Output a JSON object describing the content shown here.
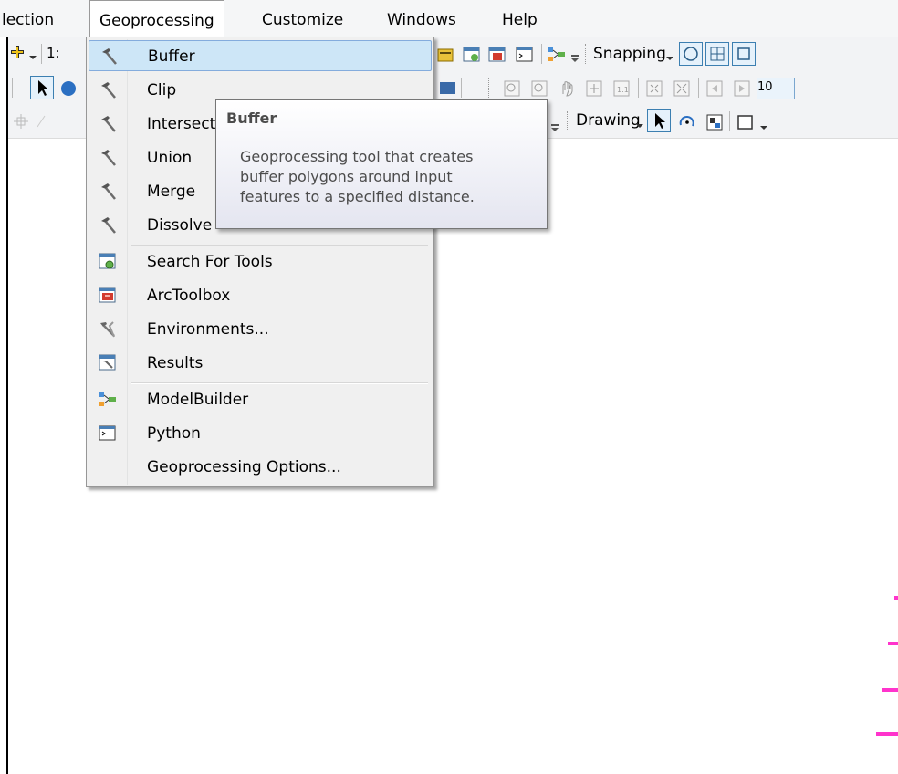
{
  "menubar": {
    "items": [
      "lection",
      "Geoprocessing",
      "Customize",
      "Windows",
      "Help"
    ]
  },
  "toolbar": {
    "scale_prefix": "1:",
    "snapping_label": "Snapping",
    "drawing_label": "Drawing",
    "zoom_fragment": "10"
  },
  "menu": {
    "items": [
      {
        "label": "Buffer",
        "icon": "hammer-icon"
      },
      {
        "label": "Clip",
        "icon": "hammer-icon"
      },
      {
        "label": "Intersect",
        "icon": "hammer-icon"
      },
      {
        "label": "Union",
        "icon": "hammer-icon"
      },
      {
        "label": "Merge",
        "icon": "hammer-icon"
      },
      {
        "label": "Dissolve",
        "icon": "hammer-icon"
      },
      {
        "label": "Search For Tools",
        "icon": "search-tools-icon"
      },
      {
        "label": "ArcToolbox",
        "icon": "toolbox-icon"
      },
      {
        "label": "Environments...",
        "icon": "environments-icon"
      },
      {
        "label": "Results",
        "icon": "results-icon"
      },
      {
        "label": "ModelBuilder",
        "icon": "modelbuilder-icon"
      },
      {
        "label": "Python",
        "icon": "python-icon"
      },
      {
        "label": "Geoprocessing Options...",
        "icon": ""
      }
    ]
  },
  "tooltip": {
    "title": "Buffer",
    "lines": [
      "Geoprocessing tool that creates",
      "buffer polygons around input",
      "features to a specified distance."
    ]
  },
  "colors": {
    "highlight": "#cde6f7",
    "highlight_border": "#84acdd",
    "marker": "#ff33cc"
  }
}
